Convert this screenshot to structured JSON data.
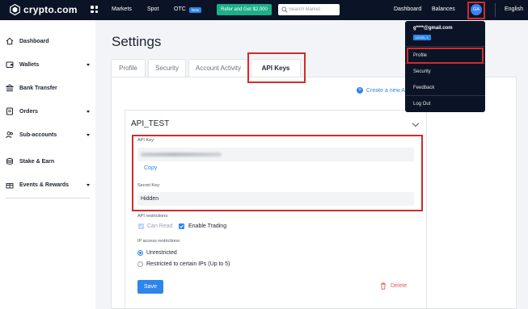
{
  "topbar": {
    "logo_text": "crypto.com",
    "nav": [
      "Markets",
      "Spot",
      "OTC"
    ],
    "otc_badge": "New",
    "refer_button": "Refer and Get $2,000",
    "search_placeholder": "Search Market",
    "right_nav": [
      "Dashboard",
      "Balances"
    ],
    "avatar_initials": "GA",
    "language": "English"
  },
  "sidebar": {
    "items": [
      {
        "label": "Dashboard",
        "icon": "house-icon",
        "has_caret": false
      },
      {
        "label": "Wallets",
        "icon": "wallet-icon",
        "has_caret": true
      },
      {
        "label": "Bank Transfer",
        "icon": "bank-icon",
        "has_caret": false
      },
      {
        "label": "Orders",
        "icon": "orders-icon",
        "has_caret": true
      },
      {
        "label": "Sub-accounts",
        "icon": "users-icon",
        "has_caret": true
      },
      {
        "label": "Stake & Earn",
        "icon": "coins-icon",
        "has_caret": false
      },
      {
        "label": "Events & Rewards",
        "icon": "gift-icon",
        "has_caret": true
      }
    ]
  },
  "page": {
    "title": "Settings",
    "tabs": [
      "Profile",
      "Security",
      "Account Activity",
      "API Keys"
    ],
    "active_tab": "API Keys",
    "create_new": "Create a new A"
  },
  "api_card": {
    "name": "API_TEST",
    "api_key_label": "API Key:",
    "copy_label": "Copy",
    "secret_key_label": "Secret Key:",
    "secret_key_value": "Hidden",
    "restrictions_label": "API restrictions:",
    "can_read_label": "Can Read",
    "enable_trading_label": "Enable Trading",
    "ip_label": "IP access restrictions:",
    "unrestricted_label": "Unrestricted",
    "restricted_label": "Restricted to certain IPs (Up to 5)",
    "save_label": "Save",
    "delete_label": "Delete"
  },
  "dropdown": {
    "email": "g****@gmail.com",
    "level": "LEVEL 1",
    "items": [
      "Profile",
      "Security",
      "Feedback",
      "Log Out"
    ]
  },
  "colors": {
    "topbar_bg": "#0b1426",
    "accent_blue": "#2d86eb",
    "refer_green": "#1eaf8a",
    "highlight_red": "#d22b2b",
    "delete_red": "#e15b5b"
  }
}
